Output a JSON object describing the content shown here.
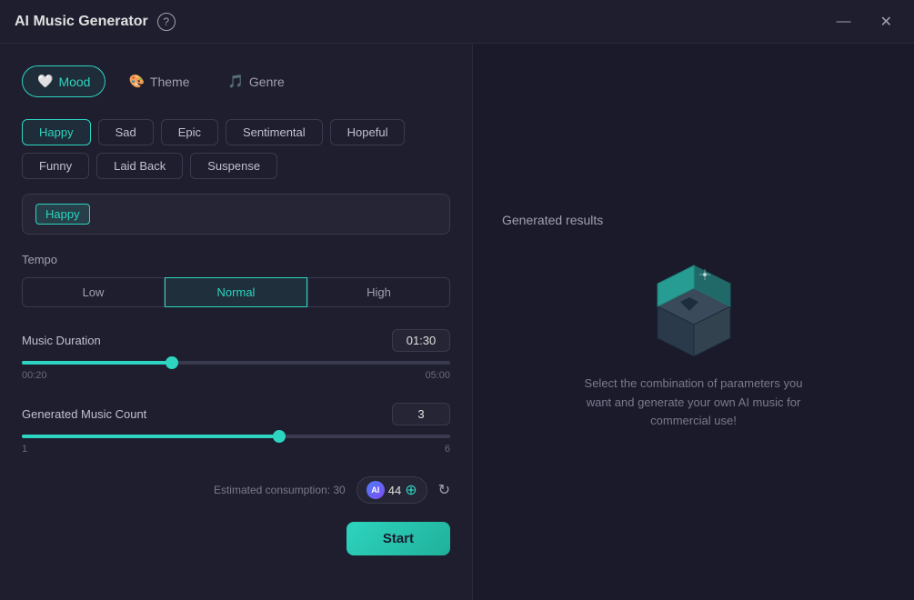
{
  "titleBar": {
    "title": "AI Music Generator",
    "helpLabel": "?",
    "minimizeLabel": "—",
    "closeLabel": "✕"
  },
  "tabs": [
    {
      "id": "mood",
      "label": "Mood",
      "active": true,
      "icon": "heart"
    },
    {
      "id": "theme",
      "label": "Theme",
      "active": false,
      "icon": "theme"
    },
    {
      "id": "genre",
      "label": "Genre",
      "active": false,
      "icon": "genre"
    }
  ],
  "moodOptions": [
    {
      "label": "Happy",
      "selected": true
    },
    {
      "label": "Sad",
      "selected": false
    },
    {
      "label": "Epic",
      "selected": false
    },
    {
      "label": "Sentimental",
      "selected": false
    },
    {
      "label": "Hopeful",
      "selected": false
    },
    {
      "label": "Funny",
      "selected": false
    },
    {
      "label": "Laid Back",
      "selected": false
    },
    {
      "label": "Suspense",
      "selected": false
    }
  ],
  "selectedMood": "Happy",
  "tempo": {
    "label": "Tempo",
    "options": [
      "Low",
      "Normal",
      "High"
    ],
    "active": "Normal"
  },
  "musicDuration": {
    "label": "Music Duration",
    "min": "00:20",
    "max": "05:00",
    "value": "01:30",
    "fillPercent": 35
  },
  "musicCount": {
    "label": "Generated Music Count",
    "min": "1",
    "max": "6",
    "value": "3",
    "fillPercent": 60
  },
  "bottomBar": {
    "estimatedConsumption": "Estimated consumption: 30",
    "credits": "44",
    "startLabel": "Start"
  },
  "rightPanel": {
    "title": "Generated results",
    "emptyText": "Select the combination of parameters you want and generate your own AI music for commercial use!"
  }
}
